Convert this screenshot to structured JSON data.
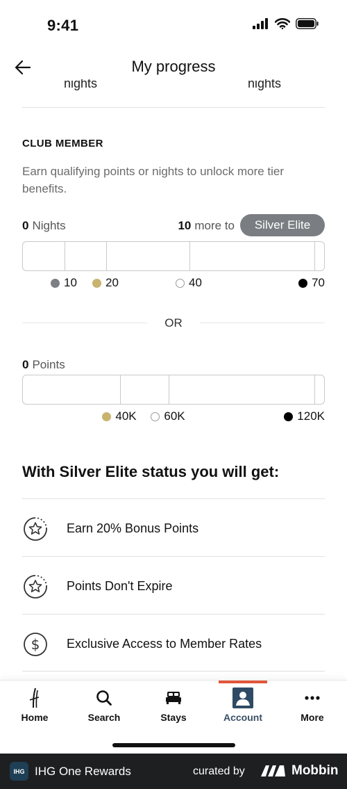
{
  "status_bar": {
    "time": "9:41"
  },
  "header": {
    "title": "My progress"
  },
  "cut_off": {
    "left": "nights",
    "right": "nights"
  },
  "tier_section": {
    "label": "CLUB MEMBER",
    "description": "Earn qualifying points or nights to unlock more tier benefits."
  },
  "nights": {
    "count": "0",
    "unit": "Nights",
    "more_count": "10",
    "more_text": "more to",
    "target_tier": "Silver Elite",
    "current_value": 0,
    "max_value": 70,
    "milestones": [
      {
        "label": "10",
        "value": 10,
        "color": "#7c7f83",
        "fill": true
      },
      {
        "label": "20",
        "value": 20,
        "color": "#c8b46e",
        "fill": true
      },
      {
        "label": "40",
        "value": 40,
        "color": "#e4e4e4",
        "fill": false
      },
      {
        "label": "70",
        "value": 70,
        "color": "#000000",
        "fill": true
      }
    ]
  },
  "or_label": "OR",
  "points": {
    "count": "0",
    "unit": "Points",
    "current_value": 0,
    "max_value": 120,
    "milestones": [
      {
        "label": "40K",
        "value": 40,
        "color": "#c8b46e",
        "fill": true
      },
      {
        "label": "60K",
        "value": 60,
        "color": "#e4e4e4",
        "fill": false
      },
      {
        "label": "120K",
        "value": 120,
        "color": "#000000",
        "fill": true
      }
    ]
  },
  "benefits": {
    "title": "With Silver Elite status you will get:",
    "items": [
      {
        "label": "Earn 20% Bonus Points",
        "icon": "star-badge-icon"
      },
      {
        "label": "Points Don't Expire",
        "icon": "star-badge-icon"
      },
      {
        "label": "Exclusive Access to Member Rates",
        "icon": "dollar-circle-icon"
      }
    ]
  },
  "bottom_nav": {
    "items": [
      {
        "label": "Home",
        "icon": "ihg-logo-icon"
      },
      {
        "label": "Search",
        "icon": "search-icon"
      },
      {
        "label": "Stays",
        "icon": "bed-icon"
      },
      {
        "label": "Account",
        "icon": "account-icon"
      },
      {
        "label": "More",
        "icon": "more-dots-icon"
      }
    ],
    "active_index": 3,
    "accent_color": "#e2553a"
  },
  "footer": {
    "logo_text": "IHG",
    "app_name": "IHG One Rewards",
    "curated_by": "curated by",
    "brand": "Mobbin"
  }
}
